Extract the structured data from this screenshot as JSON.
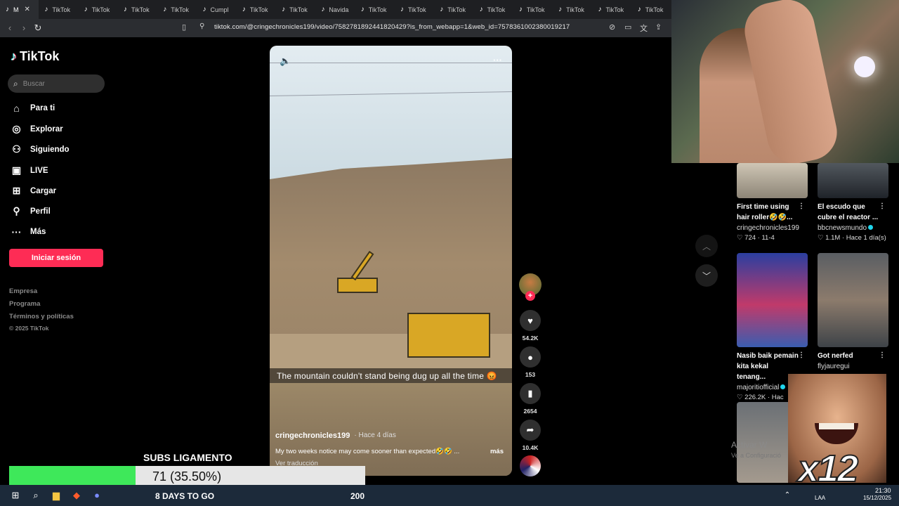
{
  "browser": {
    "tabs": [
      {
        "label": "M",
        "active": true
      },
      {
        "label": "TikTok"
      },
      {
        "label": "TikTok"
      },
      {
        "label": "TikTok"
      },
      {
        "label": "TikTok"
      },
      {
        "label": "Cumpl"
      },
      {
        "label": "TikTok"
      },
      {
        "label": "TikTok"
      },
      {
        "label": "Navida"
      },
      {
        "label": "TikTok"
      },
      {
        "label": "TikTok"
      },
      {
        "label": "TikTok"
      },
      {
        "label": "TikTok"
      },
      {
        "label": "TikTok"
      },
      {
        "label": "TikTok"
      },
      {
        "label": "TikTok"
      },
      {
        "label": "TikTok"
      }
    ],
    "url": "tiktok.com/@cringechronicles199/video/7582781892441820429?is_from_webapp=1&web_id=7578361002380019217"
  },
  "sidebar": {
    "logo": "TikTok",
    "search_placeholder": "Buscar",
    "nav": [
      {
        "label": "Para ti",
        "icon": "home-icon"
      },
      {
        "label": "Explorar",
        "icon": "compass-icon"
      },
      {
        "label": "Siguiendo",
        "icon": "following-icon"
      },
      {
        "label": "LIVE",
        "icon": "live-icon"
      },
      {
        "label": "Cargar",
        "icon": "upload-icon"
      },
      {
        "label": "Perfil",
        "icon": "profile-icon"
      },
      {
        "label": "Más",
        "icon": "more-icon"
      }
    ],
    "login_label": "Iniciar sesión",
    "footer": [
      "Empresa",
      "Programa",
      "Términos y políticas"
    ],
    "copyright": "© 2025 TikTok"
  },
  "video": {
    "caption_overlay": "The mountain couldn't stand being dug up all the time 😡",
    "author": "cringechronicles199",
    "posted": "Hace 4 días",
    "description": "My two weeks notice may come sooner than expected🤣🤣 ...",
    "more_label": "más",
    "translate_label": "Ver traducción",
    "likes": "54.2K",
    "comments": "153",
    "saves": "2654",
    "shares": "10.4K"
  },
  "related": [
    {
      "title": "First time using hair roller🤣🤣...",
      "user": "cringechronicles199",
      "verified": false,
      "likes": "724",
      "when": "11-4"
    },
    {
      "title": "El escudo que cubre el reactor ...",
      "user": "bbcnewsmundo",
      "verified": true,
      "likes": "1.1M",
      "when": "Hace 1 día(s)"
    },
    {
      "title": "Nasib baik pemain kita kekal tenang...",
      "user": "majoritiofficial",
      "verified": true,
      "likes": "226.2K",
      "when": "Hac"
    },
    {
      "title": "Got nerfed",
      "user": "flyjauregui",
      "verified": false,
      "likes": "",
      "when": ""
    }
  ],
  "watermark": {
    "line1": "Activar W",
    "line2": "Ve a Configuració"
  },
  "stream_overlay": {
    "title": "SUBS LIGAMENTO",
    "current": "71 (35.50%)",
    "progress": 0.355,
    "days": "8 DAYS TO GO",
    "target": "200",
    "multiplier": "x12"
  },
  "taskbar": {
    "time": "21:30",
    "date": "15/12/2025",
    "lang": "LAA"
  },
  "colors": {
    "accent": "#fe2c55",
    "progress": "#3ee85a",
    "background": "#000000"
  }
}
